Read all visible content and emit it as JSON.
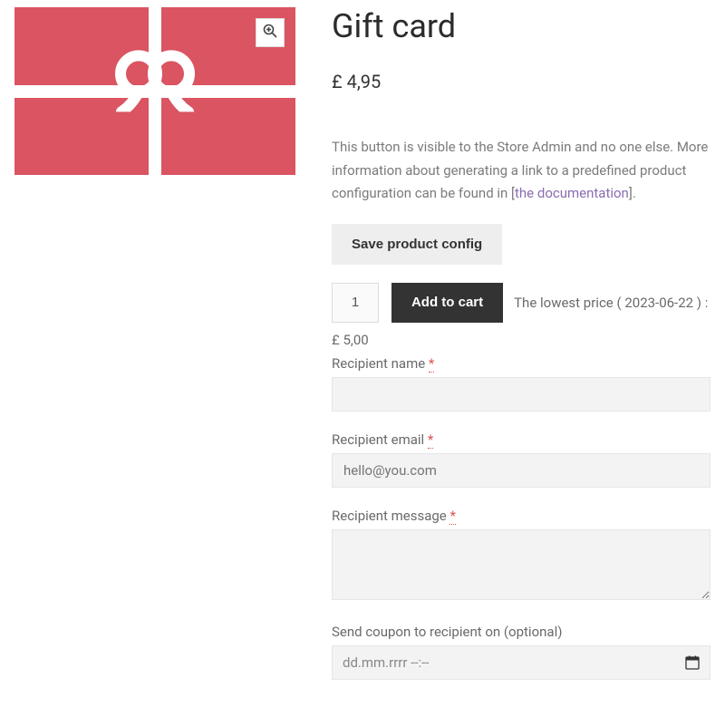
{
  "product": {
    "title": "Gift card",
    "price": "£ 4,95",
    "image_alt": "Gift card"
  },
  "admin_note": {
    "prefix": "This button is visible to the Store Admin and no one else. More information about generating a link to a predefined product configuration can be found in [",
    "link_text": "the documentation",
    "suffix": "]."
  },
  "buttons": {
    "save_config": "Save product config",
    "add_to_cart": "Add to cart"
  },
  "cart": {
    "quantity": "1",
    "lowest_price_label": "The lowest price ( 2023-06-22 ) :",
    "lowest_price_value": "£ 5,00"
  },
  "fields": {
    "recipient_name": {
      "label": "Recipient name ",
      "required": "*",
      "value": ""
    },
    "recipient_email": {
      "label": "Recipient email ",
      "required": "*",
      "placeholder": "hello@you.com",
      "value": ""
    },
    "recipient_message": {
      "label": "Recipient message ",
      "required": "*",
      "value": ""
    },
    "send_date": {
      "label": "Send coupon to recipient on (optional)",
      "placeholder": "dd.mm.rrrr --:--",
      "value": ""
    }
  }
}
